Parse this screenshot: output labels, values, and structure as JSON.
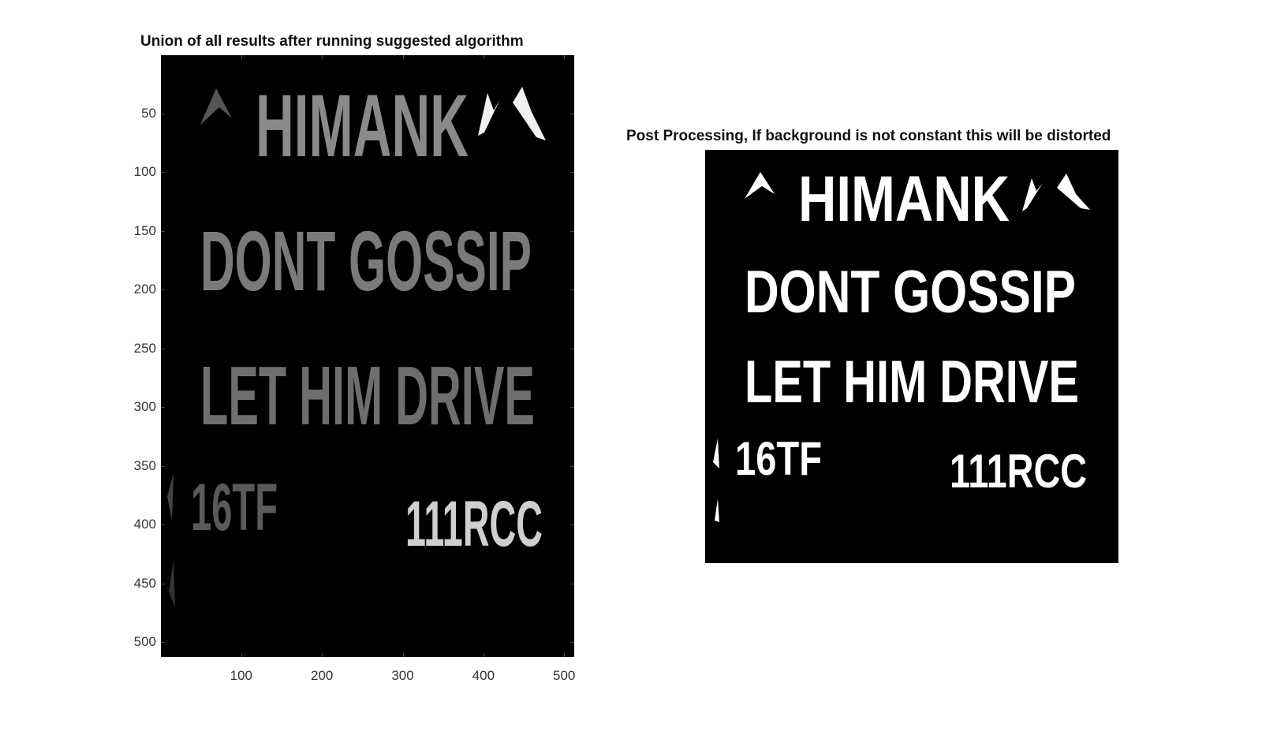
{
  "left_panel": {
    "title": "Union of all results after running suggested algorithm",
    "y_ticks": [
      "50",
      "100",
      "150",
      "200",
      "250",
      "300",
      "350",
      "400",
      "450",
      "500"
    ],
    "x_ticks": [
      "100",
      "200",
      "300",
      "400",
      "500"
    ],
    "lines": [
      {
        "text": "HIMANK",
        "shade": "#8a8a8a"
      },
      {
        "text": "DONT GOSSIP",
        "shade": "#7a7a7a"
      },
      {
        "text": "LET HIM DRIVE",
        "shade": "#6e6e6e"
      },
      {
        "text": "16TF",
        "shade": "#5a5a5a"
      },
      {
        "text": "111RCC",
        "shade": "#cfcfcf"
      }
    ]
  },
  "right_panel": {
    "title": "Post Processing, If background is not constant this will be distorted",
    "lines": [
      {
        "text": "HIMANK"
      },
      {
        "text": "DONT GOSSIP"
      },
      {
        "text": "LET HIM DRIVE"
      },
      {
        "text": "16TF"
      },
      {
        "text": "111RCC"
      }
    ]
  },
  "colors": {
    "background": "#000000",
    "figure": "#ffffff",
    "text_fg": "#ffffff"
  }
}
